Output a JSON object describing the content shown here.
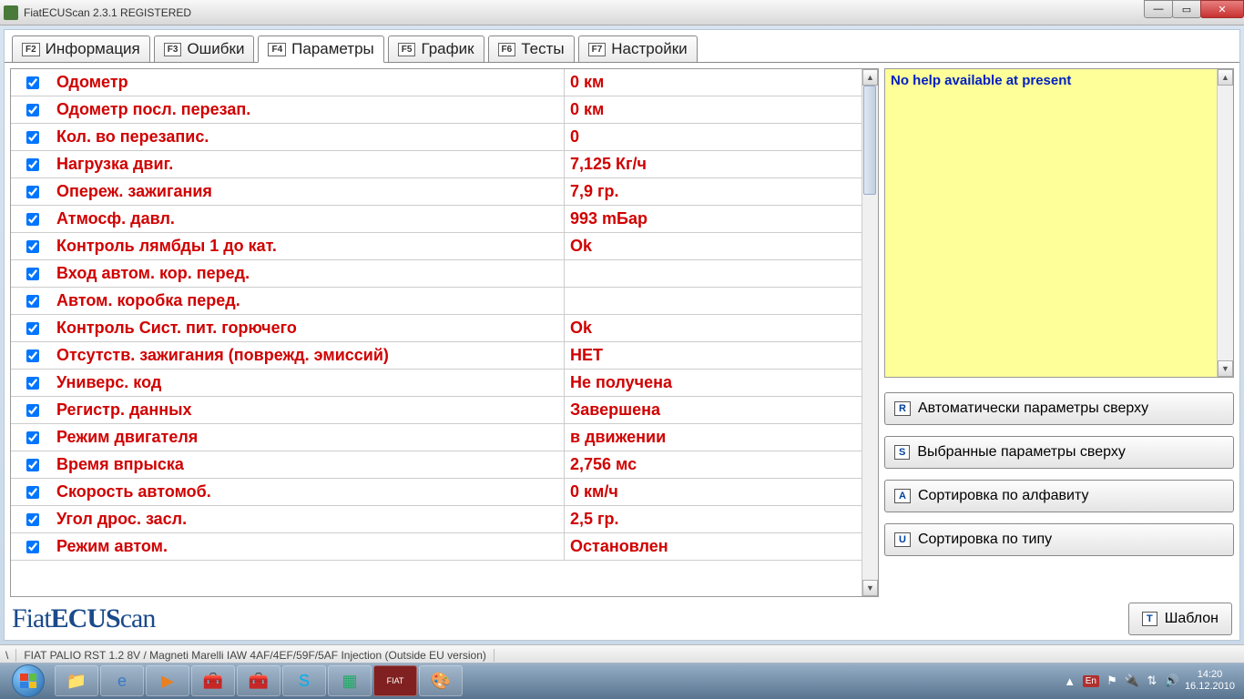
{
  "window": {
    "title": "FiatECUScan 2.3.1 REGISTERED"
  },
  "tabs": [
    {
      "key": "F2",
      "label": "Информация"
    },
    {
      "key": "F3",
      "label": "Ошибки"
    },
    {
      "key": "F4",
      "label": "Параметры"
    },
    {
      "key": "F5",
      "label": "График"
    },
    {
      "key": "F6",
      "label": "Тесты"
    },
    {
      "key": "F7",
      "label": "Настройки"
    }
  ],
  "active_tab": 2,
  "parameters": [
    {
      "name": "Одометр",
      "value": "0 км"
    },
    {
      "name": "Одометр посл. перезап.",
      "value": "0 км"
    },
    {
      "name": "Кол. во перезапис.",
      "value": "0"
    },
    {
      "name": "Нагрузка двиг.",
      "value": "7,125 Кг/ч"
    },
    {
      "name": "Опереж. зажигания",
      "value": "7,9 гр."
    },
    {
      "name": "Атмосф. давл.",
      "value": "993 mБар"
    },
    {
      "name": "Контроль лямбды 1 до кат.",
      "value": "Ok"
    },
    {
      "name": "Вход автом. кор. перед.",
      "value": ""
    },
    {
      "name": "Автом. коробка перед.",
      "value": ""
    },
    {
      "name": "Контроль Сист. пит. горючего",
      "value": "Ok"
    },
    {
      "name": "Отсутств. зажигания (поврежд. эмиссий)",
      "value": "НЕТ"
    },
    {
      "name": "Универс. код",
      "value": "Не получена"
    },
    {
      "name": "Регистр. данных",
      "value": "Завершена"
    },
    {
      "name": "Режим двигателя",
      "value": "в движении"
    },
    {
      "name": "Время впрыска",
      "value": "2,756 мс"
    },
    {
      "name": "Скорость автомоб.",
      "value": "0 км/ч"
    },
    {
      "name": "Угол дрос. засл.",
      "value": "2,5 гр."
    },
    {
      "name": "Режим автом.",
      "value": "Остановлен"
    }
  ],
  "help": {
    "text": "No help available at present"
  },
  "sort_buttons": [
    {
      "key": "R",
      "label": "Автоматически параметры сверху"
    },
    {
      "key": "S",
      "label": "Выбранные параметры сверху"
    },
    {
      "key": "A",
      "label": "Сортировка по алфавиту"
    },
    {
      "key": "U",
      "label": "Сортировка по типу"
    }
  ],
  "template_btn": {
    "key": "T",
    "label": "Шаблон"
  },
  "logo": {
    "prefix": "Fiat",
    "bold": "ECUS",
    "suffix": "can"
  },
  "statusbar": {
    "path": "\\",
    "vehicle": "FIAT PALIO RST 1.2 8V / Magneti Marelli IAW 4AF/4EF/59F/5AF Injection (Outside EU version)"
  },
  "tray": {
    "lang": "En",
    "time": "14:20",
    "date": "16.12.2010"
  }
}
